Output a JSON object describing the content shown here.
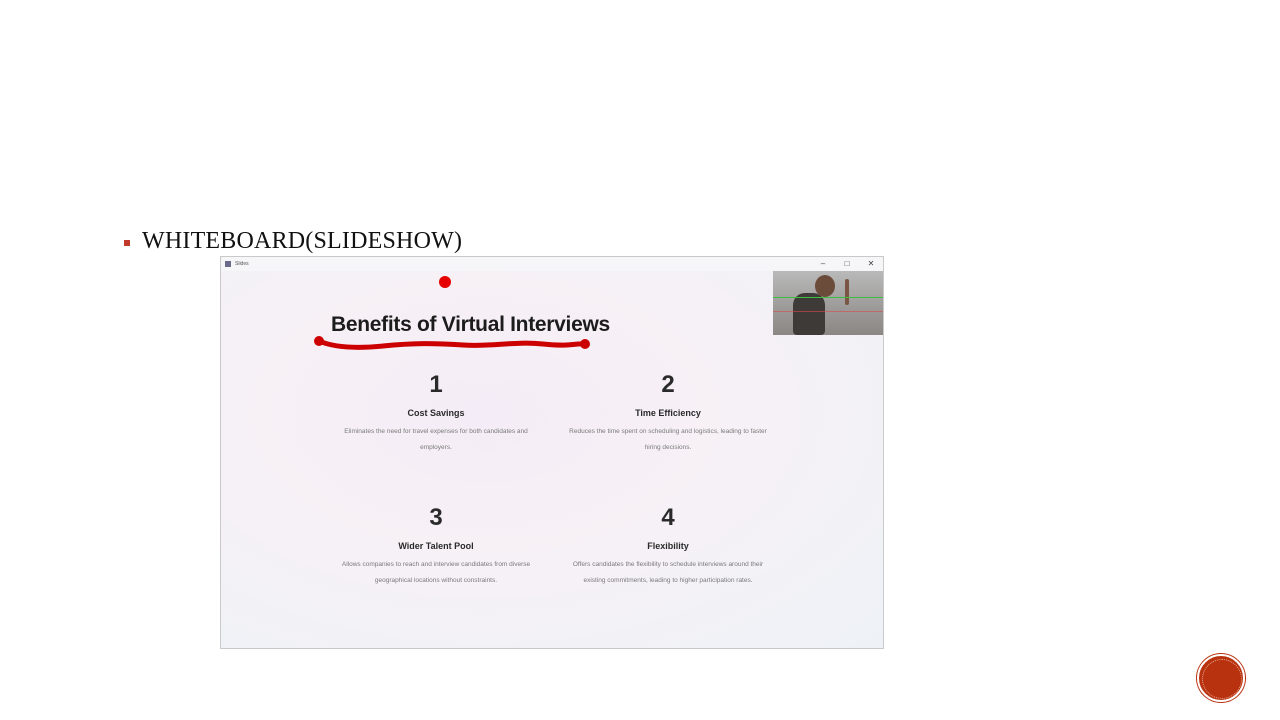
{
  "slide": {
    "bullet_text": "WHITEBOARD(SLIDESHOW)"
  },
  "window": {
    "title": "Slides",
    "controls": {
      "minimize": "–",
      "maximize": "□",
      "close": "✕"
    }
  },
  "presentation": {
    "title": "Benefits of Virtual Interviews",
    "items": [
      {
        "number": "1",
        "heading": "Cost Savings",
        "body": "Eliminates the need for travel expenses for both candidates and employers."
      },
      {
        "number": "2",
        "heading": "Time Efficiency",
        "body": "Reduces the time spent on scheduling and logistics, leading to faster hiring decisions."
      },
      {
        "number": "3",
        "heading": "Wider Talent Pool",
        "body": "Allows companies to reach and interview candidates from diverse geographical locations without constraints."
      },
      {
        "number": "4",
        "heading": "Flexibility",
        "body": "Offers candidates the flexibility to schedule interviews around their existing commitments, leading to higher participation rates."
      }
    ]
  },
  "colors": {
    "accent": "#b8320f",
    "bullet": "#c0392b",
    "ink": "#cc0000"
  },
  "icons": {
    "nav_button": "nav-circle-icon",
    "laser": "laser-pointer-icon"
  }
}
